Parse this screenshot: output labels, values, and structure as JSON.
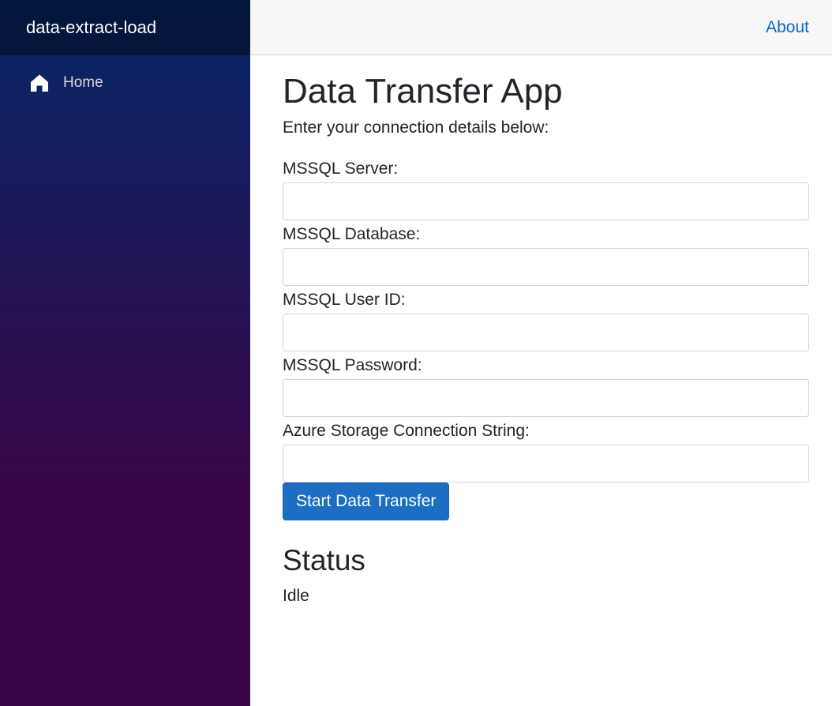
{
  "sidebar": {
    "brand": "data-extract-load",
    "nav_items": [
      {
        "label": "Home",
        "icon": "home-icon"
      }
    ],
    "colors": {
      "gradient_top": "#052767",
      "gradient_bottom": "#3a0647"
    }
  },
  "top_row": {
    "about_link": "About",
    "link_color": "#0366d6"
  },
  "main": {
    "title": "Data Transfer App",
    "intro": "Enter your connection details below:",
    "fields": [
      {
        "label": "MSSQL Server:",
        "value": "",
        "placeholder": ""
      },
      {
        "label": "MSSQL Database:",
        "value": "",
        "placeholder": ""
      },
      {
        "label": "MSSQL User ID:",
        "value": "",
        "placeholder": ""
      },
      {
        "label": "MSSQL Password:",
        "value": "",
        "placeholder": ""
      },
      {
        "label": "Azure Storage Connection String:",
        "value": "",
        "placeholder": ""
      }
    ],
    "submit_button": "Start Data Transfer",
    "button_color": "#1b6ec2",
    "status_heading": "Status",
    "status_value": "Idle"
  }
}
